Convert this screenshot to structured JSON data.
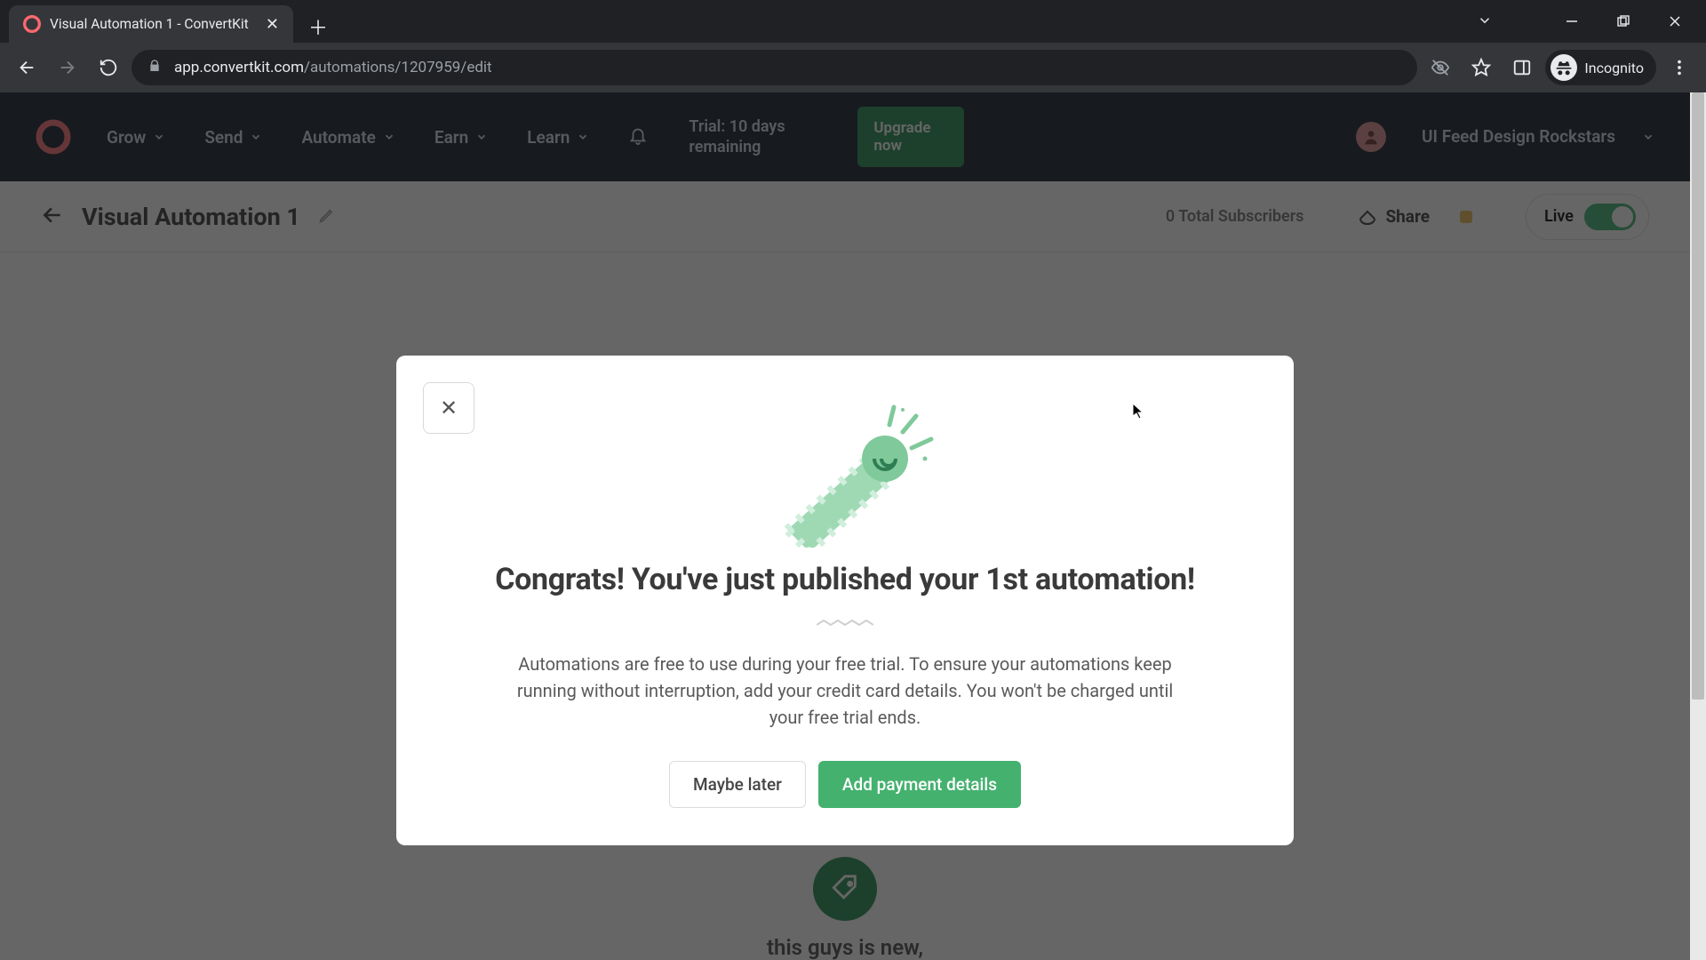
{
  "browser": {
    "tab_title": "Visual Automation 1 - ConvertKit",
    "url_host": "app.convertkit.com",
    "url_path": "/automations/1207959/edit",
    "incognito_label": "Incognito"
  },
  "nav": {
    "items": [
      "Grow",
      "Send",
      "Automate",
      "Earn",
      "Learn"
    ],
    "trial_text": "Trial: 10 days remaining",
    "upgrade_label": "Upgrade now",
    "account_name": "UI Feed Design Rockstars"
  },
  "subbar": {
    "title": "Visual Automation 1",
    "total_subs": "0 Total Subscribers",
    "share_label": "Share",
    "live_label": "Live"
  },
  "canvas": {
    "card_title": "this guys is new,"
  },
  "modal": {
    "heading": "Congrats! You've just published your 1st automation!",
    "body": "Automations are free to use during your free trial. To ensure your automations keep running without interruption, add your credit card details. You won't be charged until your free trial ends.",
    "maybe_label": "Maybe later",
    "primary_label": "Add payment details"
  }
}
